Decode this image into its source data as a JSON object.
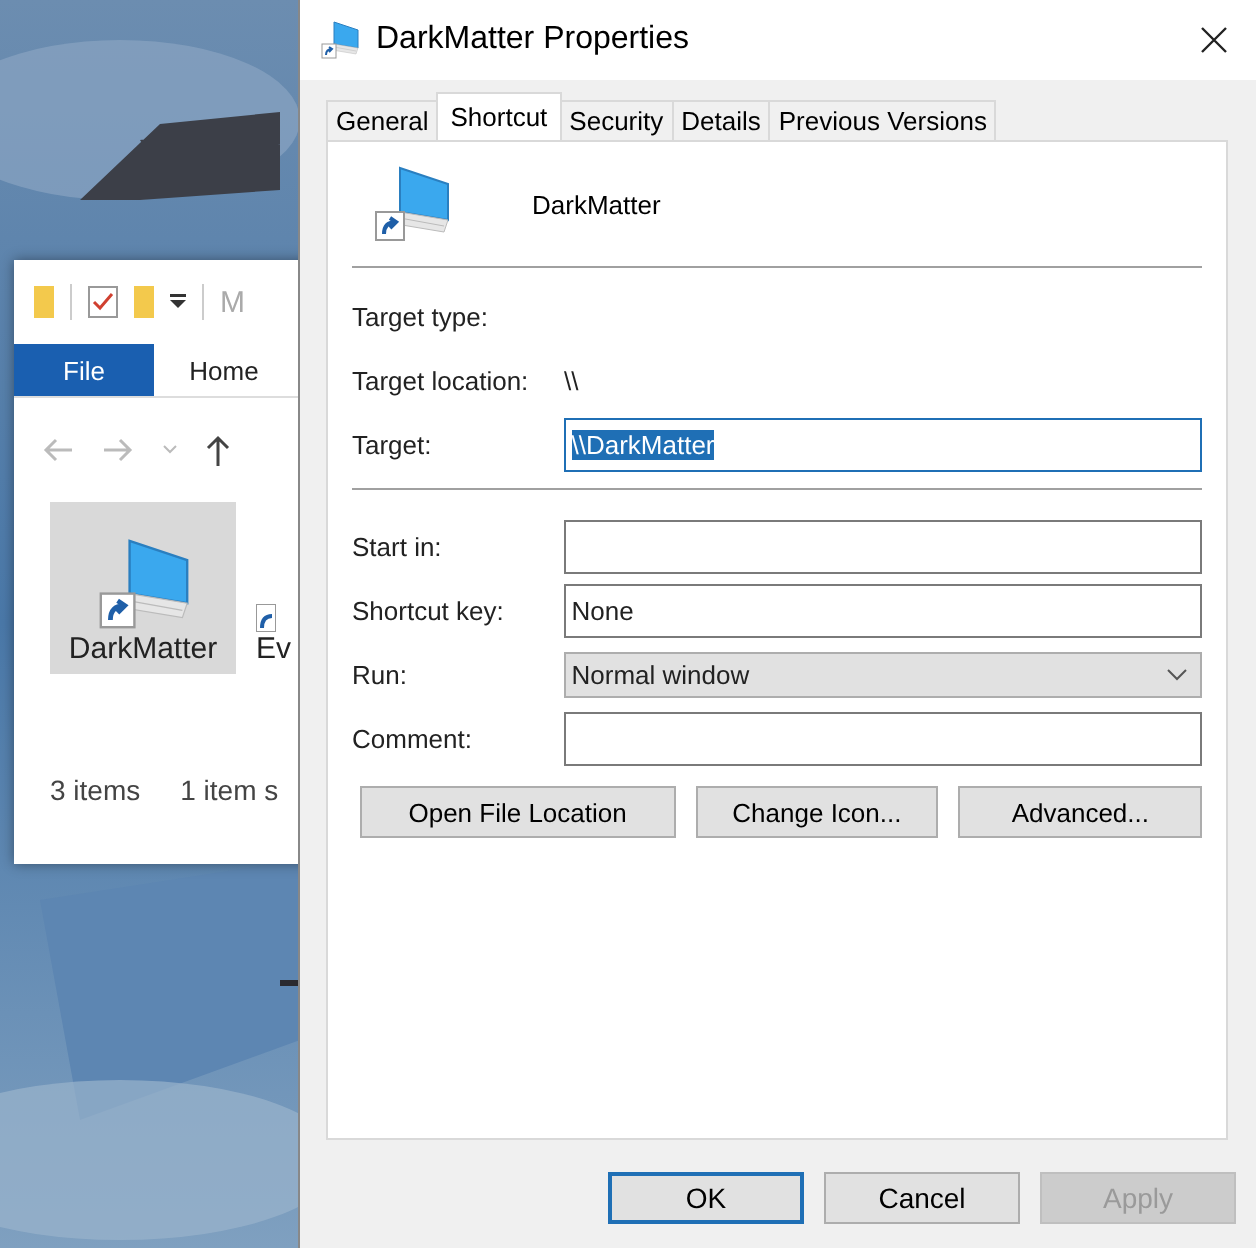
{
  "explorer": {
    "toolbar_fragment": "M",
    "ribbon_tabs": [
      {
        "label": "File",
        "selected": true
      },
      {
        "label": "Home",
        "selected": false
      }
    ],
    "items": [
      {
        "name": "DarkMatter",
        "selected": true
      },
      {
        "name": "Ev",
        "selected": false
      }
    ],
    "status": [
      "3 items",
      "1 item s"
    ]
  },
  "dialog": {
    "title": "DarkMatter Properties",
    "tabs": [
      {
        "label": "General",
        "selected": false
      },
      {
        "label": "Shortcut",
        "selected": true
      },
      {
        "label": "Security",
        "selected": false
      },
      {
        "label": "Details",
        "selected": false
      },
      {
        "label": "Previous Versions",
        "selected": false
      }
    ],
    "shortcut_name": "DarkMatter",
    "header_fields": [
      {
        "kind": "info",
        "label": "Target type:"
      },
      {
        "kind": "info",
        "label": "Target location:",
        "value": "\\\\"
      },
      {
        "kind": "input",
        "label": "Target:",
        "value": "\\\\DarkMatter",
        "highlighted": true
      }
    ],
    "fields": [
      {
        "kind": "input",
        "label": "Start in:",
        "highlighted": false
      },
      {
        "kind": "input",
        "label": "Shortcut key:",
        "value": "None",
        "highlighted": false
      },
      {
        "kind": "select",
        "label": "Run:",
        "value": "Normal window"
      },
      {
        "kind": "input",
        "label": "Comment:",
        "highlighted": false
      }
    ],
    "action_buttons": [
      "Open File Location",
      "Change Icon...",
      "Advanced..."
    ],
    "footer_buttons": [
      {
        "label": "OK",
        "default": true,
        "disabled": false
      },
      {
        "label": "Cancel",
        "default": false,
        "disabled": false
      },
      {
        "label": "Apply",
        "default": false,
        "disabled": true
      }
    ]
  }
}
